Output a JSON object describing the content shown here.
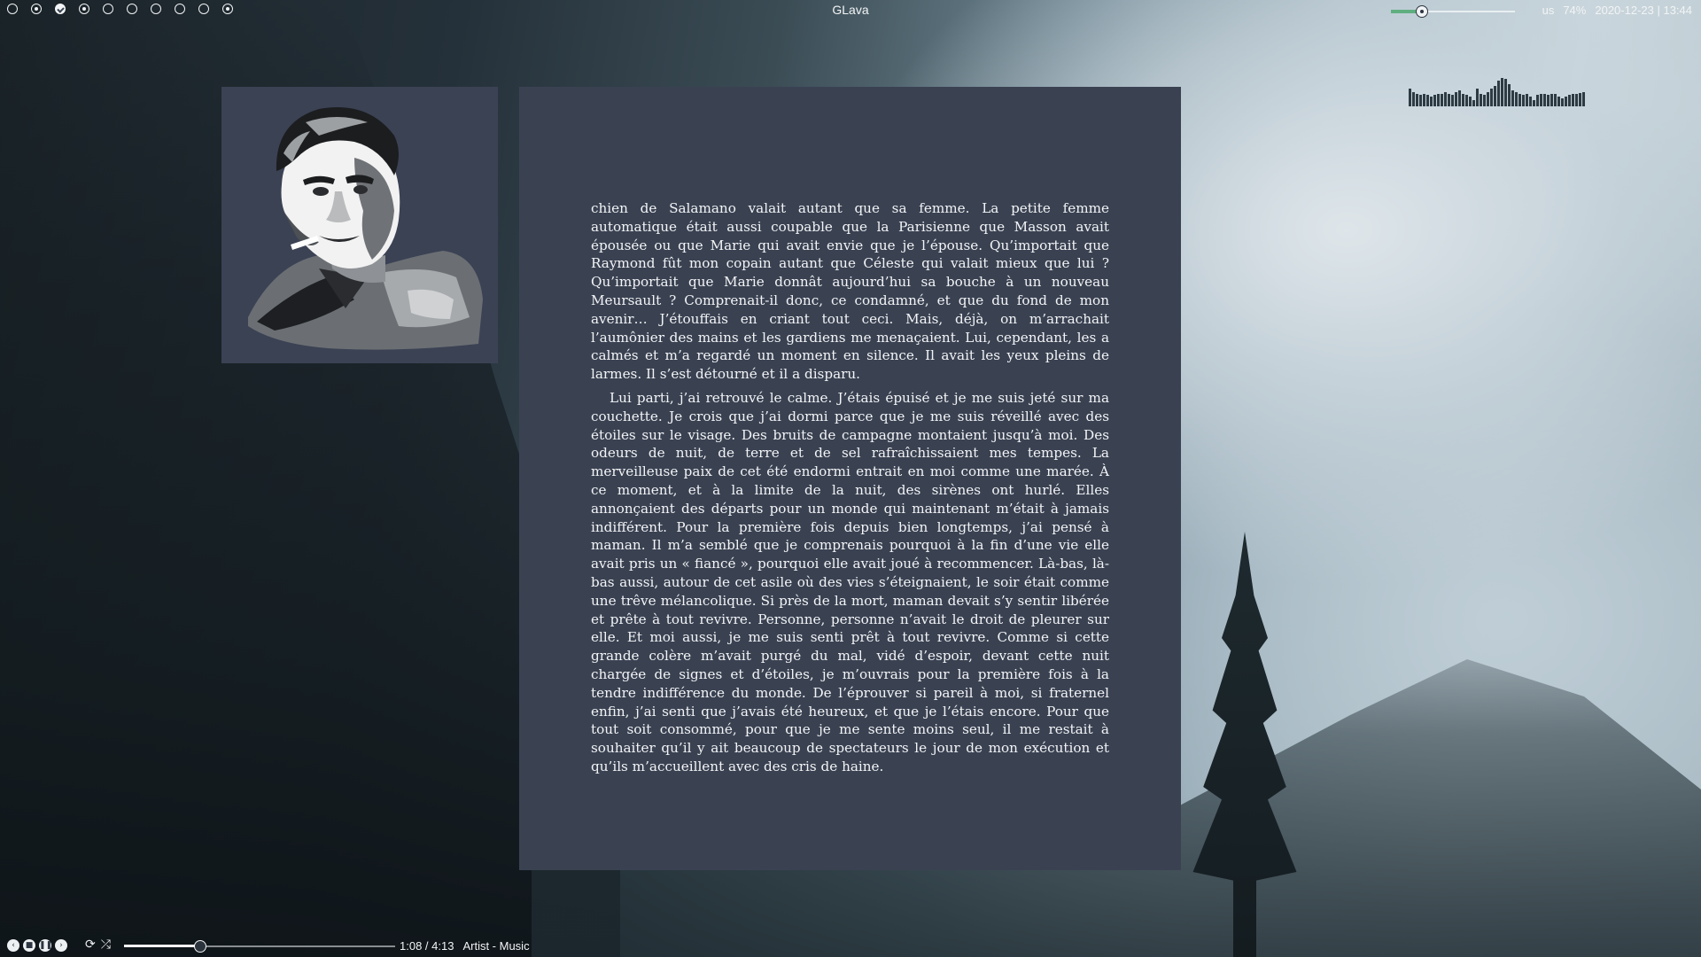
{
  "topbar": {
    "workspaces": [
      {
        "name": "workspace-1",
        "state": "empty"
      },
      {
        "name": "workspace-2",
        "state": "occupied"
      },
      {
        "name": "workspace-3",
        "state": "active"
      },
      {
        "name": "workspace-4",
        "state": "occupied"
      },
      {
        "name": "workspace-5",
        "state": "empty"
      },
      {
        "name": "workspace-6",
        "state": "empty"
      },
      {
        "name": "workspace-7",
        "state": "empty"
      },
      {
        "name": "workspace-8",
        "state": "empty"
      },
      {
        "name": "workspace-9",
        "state": "empty"
      },
      {
        "name": "workspace-10",
        "state": "occupied"
      }
    ],
    "window_title": "GLava",
    "volume_level": 0.25,
    "keyboard_layout": "us",
    "battery": "74%",
    "datetime": "2020-12-23 | 13:44"
  },
  "visualizer": {
    "levels": [
      0.55,
      0.45,
      0.4,
      0.35,
      0.38,
      0.35,
      0.3,
      0.35,
      0.4,
      0.38,
      0.45,
      0.4,
      0.35,
      0.45,
      0.5,
      0.4,
      0.35,
      0.3,
      0.2,
      0.55,
      0.4,
      0.35,
      0.45,
      0.55,
      0.65,
      0.8,
      0.9,
      0.85,
      0.7,
      0.5,
      0.45,
      0.4,
      0.35,
      0.4,
      0.3,
      0.2,
      0.35,
      0.4,
      0.38,
      0.35,
      0.4,
      0.38,
      0.3,
      0.25,
      0.3,
      0.35,
      0.38,
      0.4,
      0.42,
      0.45
    ]
  },
  "portrait": {
    "icon": "portrait-icon"
  },
  "text": {
    "paragraphs": [
      "chien de Salamano valait autant que sa femme. La petite femme automatique était aussi coupable que la Parisienne que Masson avait épousée ou que Marie qui avait envie que je l’épouse. Qu’importait que Raymond fût mon copain autant que Céleste qui valait mieux que lui ? Qu’importait que Marie donnât aujourd’hui sa bouche à un nouveau Meursault ? Comprenait-il donc, ce condamné, et que du fond de mon avenir… J’étouffais en criant tout ceci. Mais, déjà, on m’arrachait l’aumônier des mains et les gardiens me menaçaient. Lui, cependant, les a calmés et m’a regardé un moment en silence. Il avait les yeux pleins de larmes. Il s’est détourné et il a disparu.",
      "Lui parti, j’ai retrouvé le calme. J’étais épuisé et je me suis jeté sur ma couchette. Je crois que j’ai dormi parce que je me suis réveillé avec des étoiles sur le visage. Des bruits de campagne montaient jusqu’à moi. Des odeurs de nuit, de terre et de sel rafraîchissaient mes tempes. La merveilleuse paix de cet été endormi entrait en moi comme une marée. À ce moment, et à la limite de la nuit, des sirènes ont hurlé. Elles annonçaient des départs pour un monde qui maintenant m’était à jamais indifférent. Pour la première fois depuis bien longtemps, j’ai pensé à maman. Il m’a semblé que je comprenais pourquoi à la fin d’une vie elle avait pris un « fiancé », pourquoi elle avait joué à recommencer. Là-bas, là-bas aussi, autour de cet asile où des vies s’éteignaient, le soir était comme une trêve mélancolique. Si près de la mort, maman devait s’y sentir libérée et prête à tout revivre. Personne, personne n’avait le droit de pleurer sur elle. Et moi aussi, je me suis senti prêt à tout revivre. Comme si cette grande colère m’avait purgé du mal, vidé d’espoir, devant cette nuit chargée de signes et d’étoiles, je m’ouvrais pour la première fois à la tendre indifférence du monde. De l’éprouver si pareil à moi, si fraternel enfin, j’ai senti que j’avais été heureux, et que je l’étais encore. Pour que tout soit consommé, pour que je me sente moins seul, il me restait à souhaiter qu’il y ait beaucoup de spectateurs le jour de mon exécution et qu’ils m’accueillent avec des cris de haine."
    ]
  },
  "bottombar": {
    "controls": {
      "previous_icon": "‹",
      "stop_icon": "■",
      "pause_icon": "❚❚",
      "next_icon": "›",
      "repeat_icon": "⟳",
      "shuffle_icon": "⤮"
    },
    "progress": 0.28,
    "time": "1:08 / 4:13",
    "track": "Artist - Music"
  }
}
